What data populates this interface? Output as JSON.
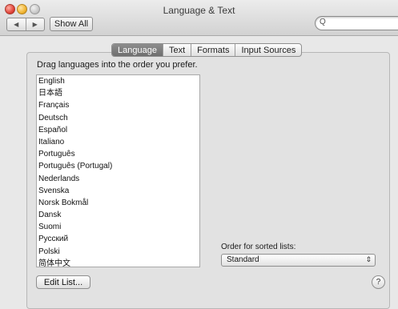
{
  "window": {
    "title": "Language & Text"
  },
  "toolbar": {
    "back_glyph": "◀",
    "forward_glyph": "▶",
    "show_all_label": "Show All",
    "search_placeholder": "",
    "search_glyph": "Q"
  },
  "tabs": [
    {
      "label": "Language",
      "active": true
    },
    {
      "label": "Text",
      "active": false
    },
    {
      "label": "Formats",
      "active": false
    },
    {
      "label": "Input Sources",
      "active": false
    }
  ],
  "language_panel": {
    "instructions": "Drag languages into the order you prefer.",
    "languages": [
      "English",
      "日本語",
      "Français",
      "Deutsch",
      "Español",
      "Italiano",
      "Português",
      "Português (Portugal)",
      "Nederlands",
      "Svenska",
      "Norsk Bokmål",
      "Dansk",
      "Suomi",
      "Русский",
      "Polski",
      "简体中文"
    ],
    "edit_list_label": "Edit List...",
    "sort_label": "Order for sorted lists:",
    "sort_value": "Standard",
    "sort_glyph": "⇕",
    "help_glyph": "?"
  },
  "colors": {
    "active_tab": "#7b7b7b",
    "window_bg": "#e6e6e6"
  }
}
